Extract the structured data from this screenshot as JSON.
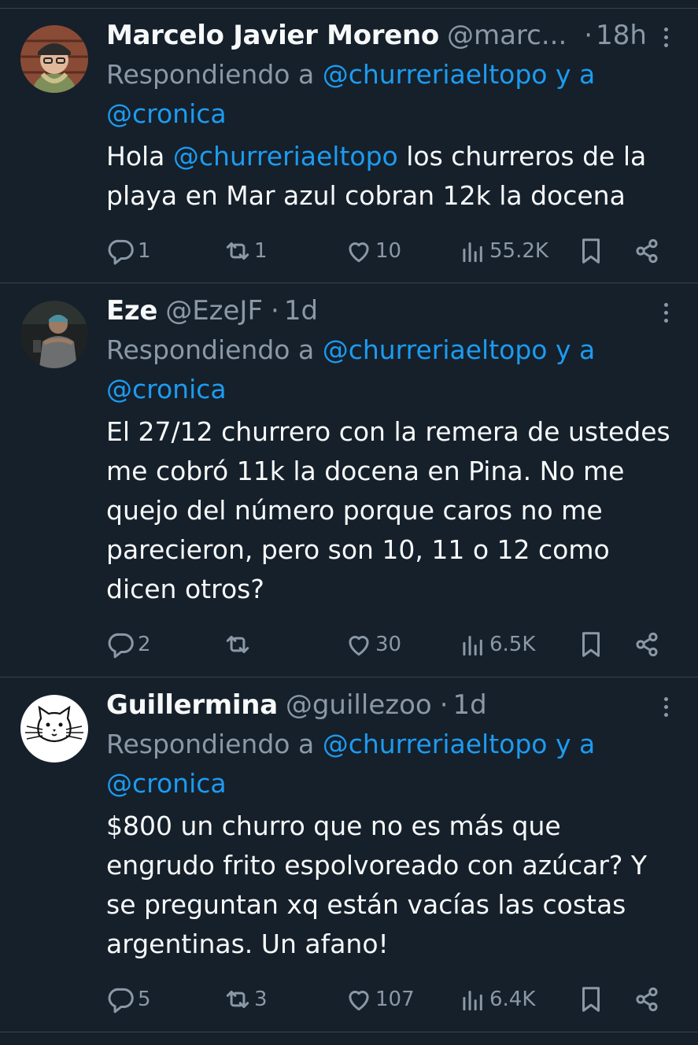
{
  "tweets": [
    {
      "name": "Marcelo Javier Moreno",
      "handle": "@marc...",
      "separator": "·",
      "time": "18h",
      "reply_prefix": "Respondiendo a",
      "reply_mention_1": "@churreriaeltopo",
      "reply_join": "y a",
      "reply_mention_2": "@cronica",
      "text_prefix": "Hola",
      "text_mention": "@churreriaeltopo",
      "text_body": "los churreros de la playa en Mar azul cobran 12k la docena",
      "replies": "1",
      "retweets": "1",
      "likes": "10",
      "views": "55.2K"
    },
    {
      "name": "Eze",
      "handle": "@EzeJF",
      "separator": "·",
      "time": "1d",
      "reply_prefix": "Respondiendo a",
      "reply_mention_1": "@churreriaeltopo",
      "reply_join": "y a",
      "reply_mention_2": "@cronica",
      "text_body": "El 27/12 churrero con la remera de ustedes me cobró 11k la docena en Pina. No me quejo del número porque caros no me parecieron, pero son 10, 11 o 12 como dicen otros?",
      "replies": "2",
      "retweets": "",
      "likes": "30",
      "views": "6.5K"
    },
    {
      "name": "Guillermina",
      "handle": "@guillezoo",
      "separator": "·",
      "time": "1d",
      "reply_prefix": "Respondiendo a",
      "reply_mention_1": "@churreriaeltopo",
      "reply_join": "y a",
      "reply_mention_2": "@cronica",
      "text_body": "$800 un churro que no es más que engrudo frito espolvoreado con azúcar? Y se preguntan xq están vacías las costas argentinas. Un afano!",
      "replies": "5",
      "retweets": "3",
      "likes": "107",
      "views": "6.4K"
    }
  ],
  "colors": {
    "background": "#15202b",
    "text": "#f7f9f9",
    "muted": "#8b98a5",
    "link": "#1d9bf0",
    "divider": "#38444d"
  },
  "icons": [
    "reply-icon",
    "retweet-icon",
    "like-icon",
    "views-icon",
    "bookmark-icon",
    "share-icon",
    "more-icon"
  ]
}
